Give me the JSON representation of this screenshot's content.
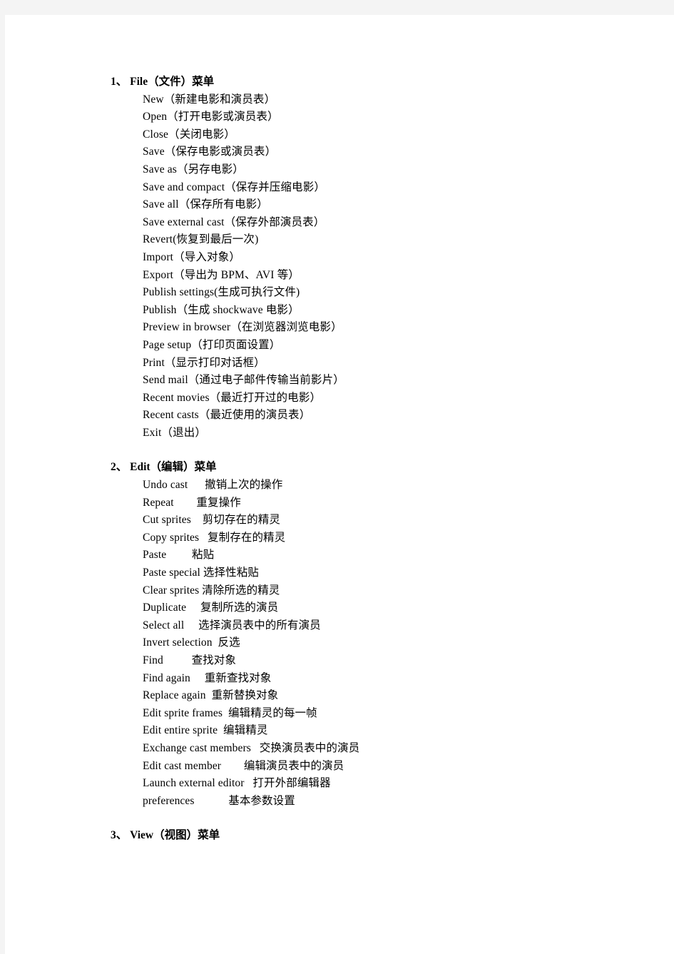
{
  "document": {
    "title_note": "Director menu reference (Chinese annotations)",
    "sections": [
      {
        "heading": "1、 File（文件）菜单",
        "number": "1、",
        "name": "File",
        "name_cn": "（文件）菜单",
        "items": [
          "New（新建电影和演员表）",
          "Open（打开电影或演员表）",
          "Close（关闭电影）",
          "Save（保存电影或演员表）",
          "Save as（另存电影）",
          "Save and compact（保存并压缩电影）",
          "Save all（保存所有电影）",
          "Save external cast（保存外部演员表）",
          "Revert(恢复到最后一次)",
          "Import（导入对象）",
          "Export（导出为 BPM、AVI 等）",
          "Publish settings(生成可执行文件)",
          "Publish（生成 shockwave 电影）",
          "Preview in browser（在浏览器浏览电影）",
          "Page setup（打印页面设置）",
          "Print（显示打印对话框）",
          "Send mail（通过电子邮件传输当前影片）",
          "Recent movies（最近打开过的电影）",
          "Recent casts（最近使用的演员表）",
          "Exit（退出）"
        ]
      },
      {
        "heading": "2、 Edit（编辑）菜单",
        "number": "2、",
        "name": "Edit",
        "name_cn": "（编辑）菜单",
        "items": [
          "Undo cast      撤销上次的操作",
          "Repeat        重复操作",
          "Cut sprites    剪切存在的精灵",
          "Copy sprites   复制存在的精灵",
          "Paste         粘贴",
          "Paste special 选择性粘贴",
          "Clear sprites 清除所选的精灵",
          "Duplicate     复制所选的演员",
          "Select all     选择演员表中的所有演员",
          "Invert selection  反选",
          "Find          查找对象",
          "Find again     重新查找对象",
          "Replace again  重新替换对象",
          "Edit sprite frames  编辑精灵的每一帧",
          "Edit entire sprite  编辑精灵",
          "Exchange cast members   交换演员表中的演员",
          "Edit cast member        编辑演员表中的演员",
          "Launch external editor   打开外部编辑器",
          "preferences            基本参数设置"
        ]
      },
      {
        "heading": "3、 View（视图）菜单",
        "number": "3、",
        "name": "View",
        "name_cn": "（视图）菜单",
        "items": []
      }
    ]
  }
}
